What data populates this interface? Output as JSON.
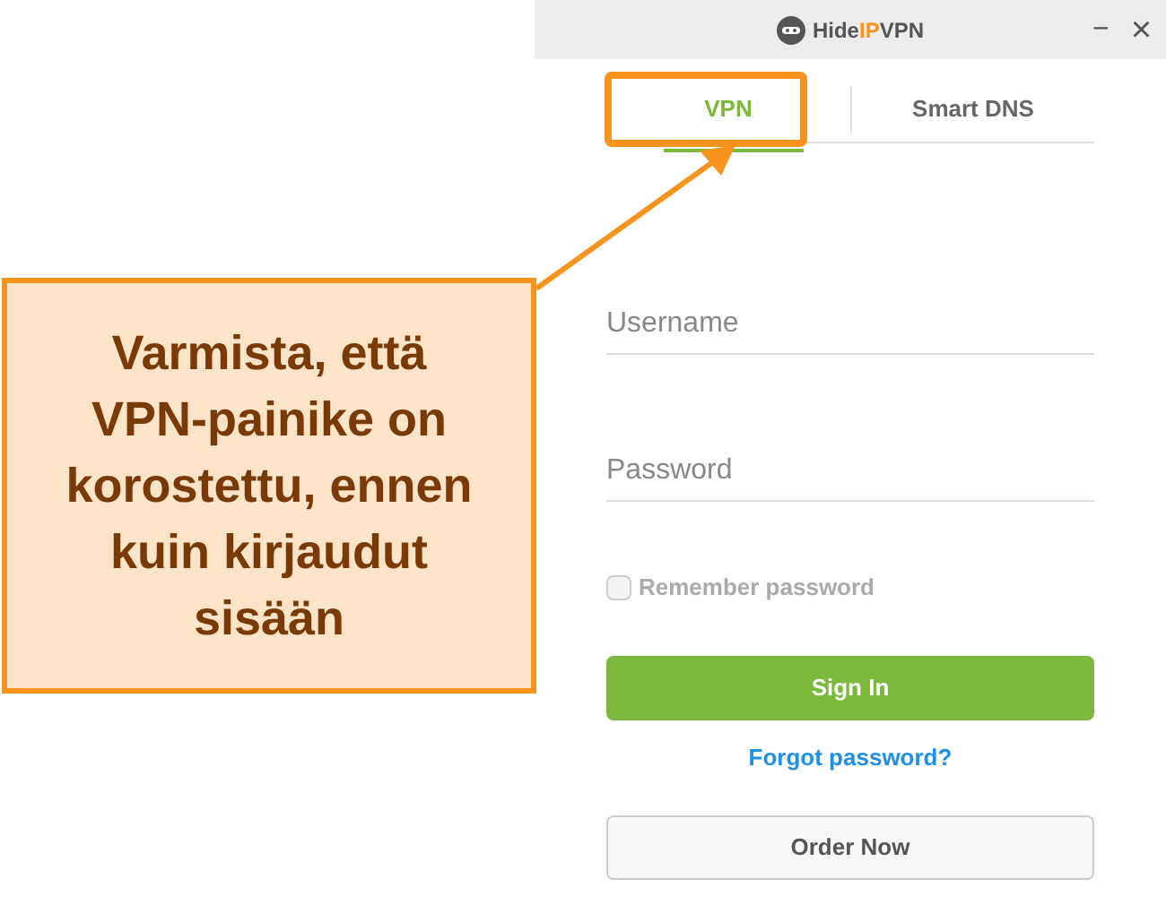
{
  "window": {
    "logo": {
      "prefix": "Hide",
      "accent": "IP",
      "suffix": "VPN"
    },
    "minimize": "−",
    "close": "×"
  },
  "tabs": [
    {
      "label": "VPN",
      "selected": true,
      "highlighted": true
    },
    {
      "label": "Smart DNS",
      "selected": false,
      "highlighted": false
    }
  ],
  "form": {
    "username": {
      "placeholder": "Username"
    },
    "password": {
      "placeholder": "Password"
    },
    "remember": {
      "label": "Remember password",
      "checked": false
    },
    "sign_in": "Sign In",
    "forgot": "Forgot password?",
    "order": "Order Now"
  },
  "annotation": {
    "text": "Varmista, että VPN-painike on korostettu, ennen kuin kirjaudut sisään"
  }
}
